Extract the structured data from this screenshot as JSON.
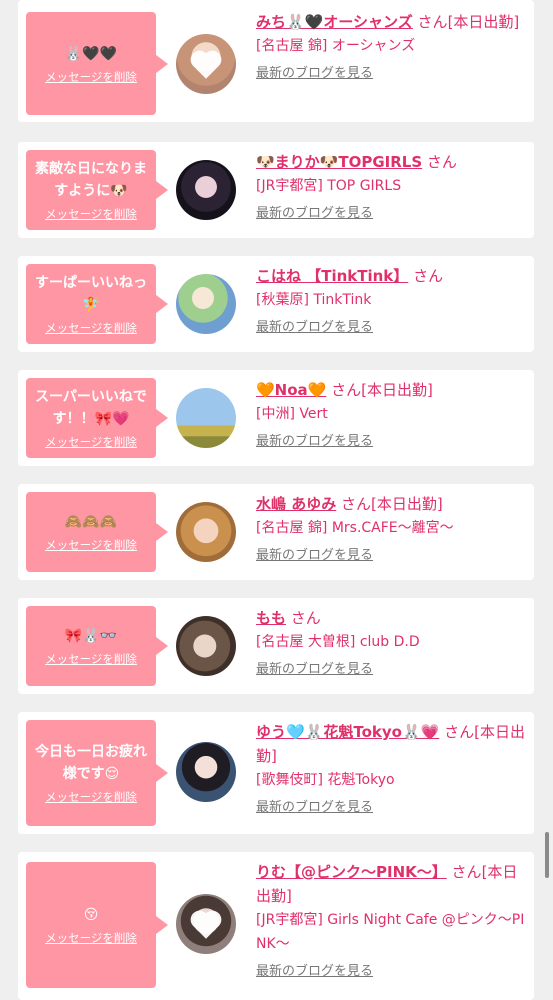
{
  "delete_label": "メッセージを削除",
  "blog_label": "最新のブログを見る",
  "suffix_san": "さん",
  "colors": {
    "bubble": "#ff96a4",
    "name": "#e0306a",
    "link_gray": "#777777",
    "bg": "#efefef"
  },
  "items": [
    {
      "message": "🐰🖤🖤",
      "name": "みち🐰🖤オーシャンズ",
      "status": "[本日出勤]",
      "shop": "[名古屋 錦] オーシャンズ",
      "avatar_icon": "heart-sticker"
    },
    {
      "message": "素敵な日になりますように🐶",
      "name": "🐶まりか🐶TOPGIRLS",
      "status": "",
      "shop": "[JR宇都宮] TOP GIRLS",
      "avatar_icon": ""
    },
    {
      "message": "すーぱーいいねっ🧚",
      "name": "こはね 【TinkTink】",
      "status": "",
      "shop": "[秋葉原] TinkTink",
      "avatar_icon": ""
    },
    {
      "message": "スーパーいいねです！！🎀💗",
      "name": "🧡Noa🧡",
      "status": "[本日出勤]",
      "shop": "[中洲] Vert",
      "avatar_icon": ""
    },
    {
      "message": "🙈🙈🙈",
      "name": "水嶋 あゆみ",
      "status": "[本日出勤]",
      "shop": "[名古屋 錦] Mrs.CAFE〜離宮〜",
      "avatar_icon": ""
    },
    {
      "message": "🎀🐰👓",
      "name": "もも",
      "status": "",
      "shop": "[名古屋 大曽根] club D.D",
      "avatar_icon": ""
    },
    {
      "message": "今日も一日お疲れ様です😌",
      "name": "ゆう🩵🐰花魁Tokyo🐰💗",
      "status": "[本日出勤]",
      "shop": "[歌舞伎町] 花魁Tokyo",
      "avatar_icon": ""
    },
    {
      "message": "😚",
      "name": "りむ【@ピンク〜PINK〜】",
      "status": "[本日出勤]",
      "shop": "[JR宇都宮] Girls Night Cafe @ピンク〜PINK〜",
      "avatar_icon": "heart-sticker"
    }
  ]
}
